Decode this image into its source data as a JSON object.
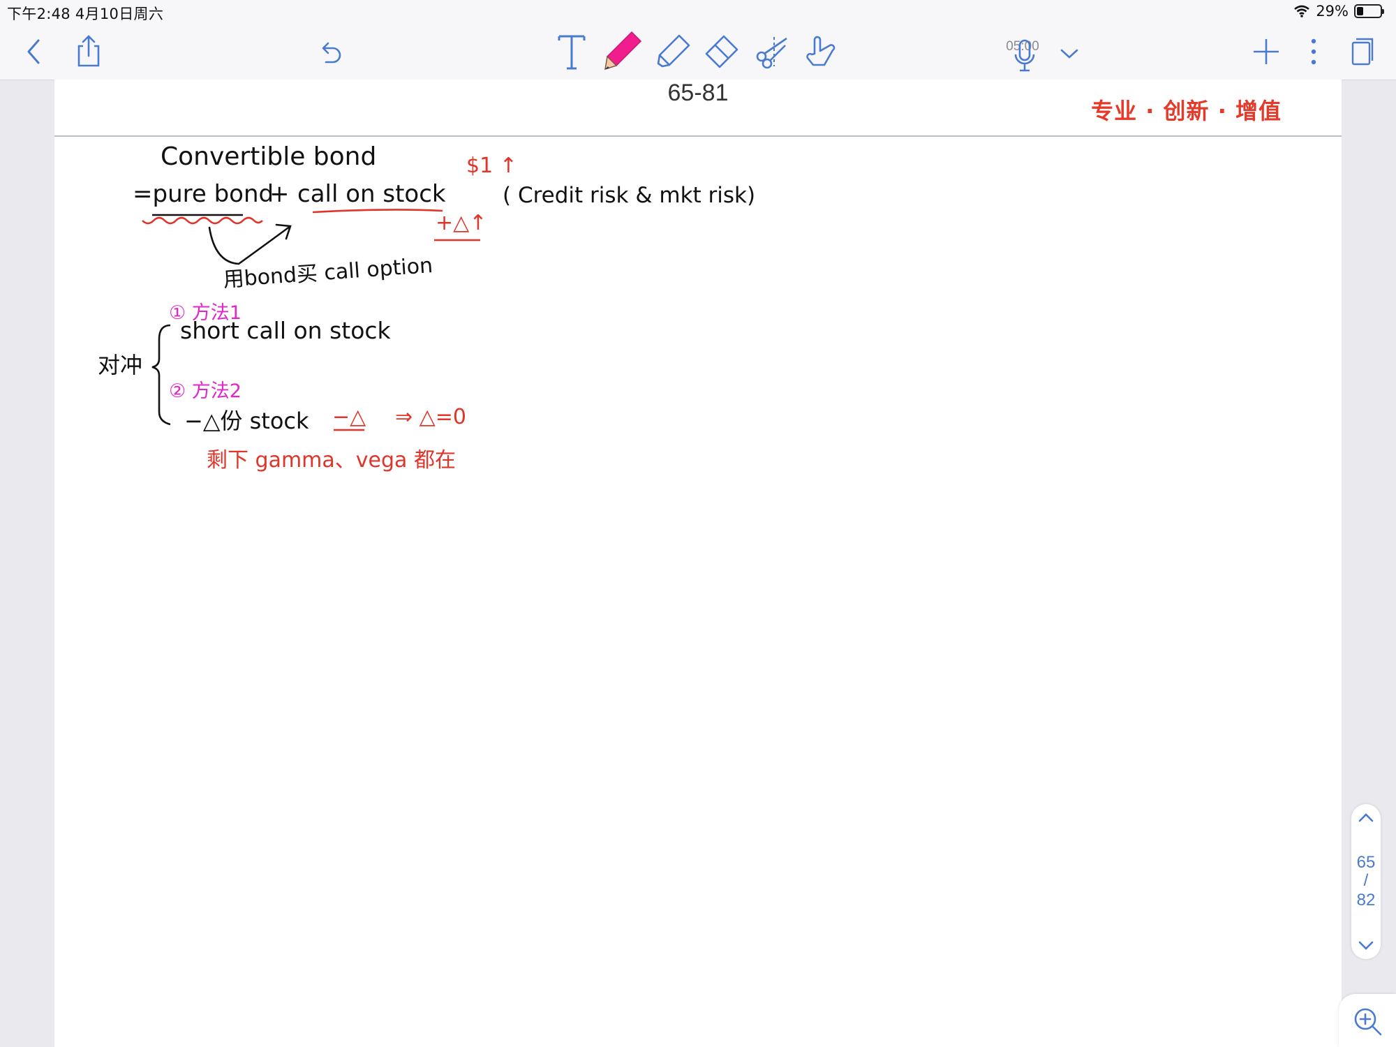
{
  "status_bar": {
    "time_date": "下午2:48   4月10日周六",
    "battery_text": "29%"
  },
  "toolbar": {
    "recording_time": "05:00",
    "icons": [
      "chevron-left-icon",
      "share-icon",
      "undo-icon",
      "text-tool-icon",
      "pen-tool-icon",
      "highlighter-icon",
      "eraser-icon",
      "lasso-scissors-icon",
      "hand-pointer-icon",
      "microphone-icon",
      "chevron-down-icon",
      "plus-icon",
      "more-vertical-icon",
      "pages-icon"
    ],
    "active_tool": "pen-tool-icon",
    "pen_color": "#f21d8d"
  },
  "page": {
    "title": "65-81",
    "slogan": "专业 · 创新 · 增值",
    "notes": {
      "line1": "Convertible bond",
      "line2a": "=pure bond",
      "line2b": "+",
      "line2c": "call on stock",
      "dollar_up": "$1 ↑",
      "risk_note": "( Credit risk & mkt risk)",
      "delta_up": "+△↑",
      "bond_buy": "用bond买 call option",
      "method1": "① 方法1",
      "hedge": "对冲",
      "short_call": "short call on stock",
      "method2": "② 方法2",
      "minus_delta": "−△份 stock",
      "neg_delta": "−△",
      "arrow_zero": "⇒ △=0",
      "remain": "剩下 gamma、vega 都在"
    }
  },
  "pager": {
    "current": "65",
    "slash": "/",
    "total": "82"
  },
  "colors": {
    "ink": "#111111",
    "red_ink": "#e0352a",
    "pink_ink": "#e326c9",
    "slogan": "#e33a2b",
    "pager": "#4a7ad0"
  }
}
